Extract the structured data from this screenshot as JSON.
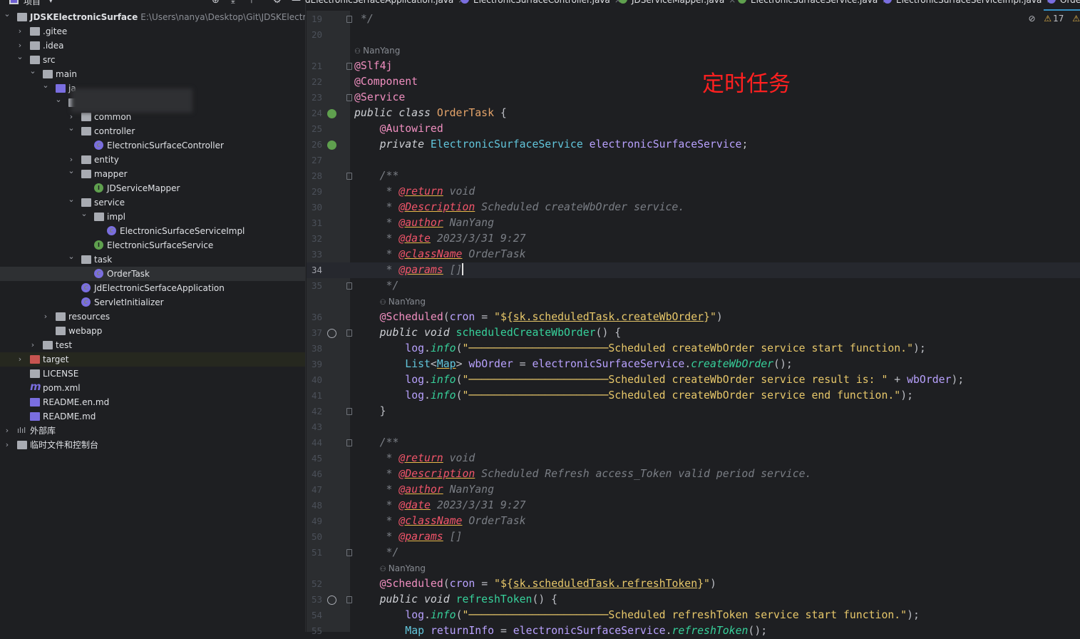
{
  "project_panel": {
    "title": "项目",
    "tree": [
      {
        "depth": 0,
        "exp": true,
        "icon": "module",
        "label": "JDSKElectronicSurface",
        "path": "E:\\Users\\nanya\\Desktop\\Git\\JDSKElectronicSurf",
        "bold": true
      },
      {
        "depth": 1,
        "exp": false,
        "icon": "folder",
        "label": ".gitee"
      },
      {
        "depth": 1,
        "exp": false,
        "icon": "folder",
        "label": ".idea"
      },
      {
        "depth": 1,
        "exp": true,
        "icon": "folder",
        "label": "src"
      },
      {
        "depth": 2,
        "exp": true,
        "icon": "folder",
        "label": "main"
      },
      {
        "depth": 3,
        "exp": true,
        "icon": "folder-blue",
        "label": "ja"
      },
      {
        "depth": 4,
        "exp": true,
        "icon": "package",
        "label": ""
      },
      {
        "depth": 5,
        "exp": false,
        "icon": "package",
        "label": "common"
      },
      {
        "depth": 5,
        "exp": true,
        "icon": "package",
        "label": "controller"
      },
      {
        "depth": 6,
        "icon": "class",
        "label": "ElectronicSurfaceController"
      },
      {
        "depth": 5,
        "exp": false,
        "icon": "package",
        "label": "entity"
      },
      {
        "depth": 5,
        "exp": true,
        "icon": "package",
        "label": "mapper"
      },
      {
        "depth": 6,
        "icon": "interface",
        "label": "JDServiceMapper"
      },
      {
        "depth": 5,
        "exp": true,
        "icon": "package",
        "label": "service"
      },
      {
        "depth": 6,
        "exp": true,
        "icon": "package",
        "label": "impl"
      },
      {
        "depth": 7,
        "icon": "class",
        "label": "ElectronicSurfaceServiceImpl"
      },
      {
        "depth": 6,
        "icon": "interface",
        "label": "ElectronicSurfaceService"
      },
      {
        "depth": 5,
        "exp": true,
        "icon": "package",
        "label": "task"
      },
      {
        "depth": 6,
        "icon": "class",
        "label": "OrderTask",
        "selected": true
      },
      {
        "depth": 5,
        "icon": "class",
        "label": "JdElectronicSerfaceApplication"
      },
      {
        "depth": 5,
        "icon": "class",
        "label": "ServletInitializer"
      },
      {
        "depth": 3,
        "exp": false,
        "icon": "folder",
        "label": "resources"
      },
      {
        "depth": 3,
        "icon": "folder",
        "label": "webapp"
      },
      {
        "depth": 2,
        "exp": false,
        "icon": "folder",
        "label": "test"
      },
      {
        "depth": 1,
        "exp": false,
        "icon": "folder-red",
        "label": "target",
        "excluded": true
      },
      {
        "depth": 1,
        "icon": "file",
        "label": "LICENSE"
      },
      {
        "depth": 1,
        "icon": "maven",
        "label": "pom.xml"
      },
      {
        "depth": 1,
        "icon": "md",
        "label": "README.en.md"
      },
      {
        "depth": 1,
        "icon": "md",
        "label": "README.md"
      },
      {
        "depth": 0,
        "exp": false,
        "icon": "library",
        "label": "外部库"
      },
      {
        "depth": 0,
        "exp": false,
        "icon": "scratch",
        "label": "临时文件和控制台"
      }
    ]
  },
  "tabs": [
    {
      "label": "JdElectronicSerfaceApplication.java",
      "type": "class"
    },
    {
      "label": "ElectronicSurfaceController.java",
      "type": "class"
    },
    {
      "label": "JDServiceMapper.java",
      "type": "interface"
    },
    {
      "label": "ElectronicSurfaceService.java",
      "type": "interface"
    },
    {
      "label": "ElectronicSurfaceServiceImpl.java",
      "type": "class"
    },
    {
      "label": "OrderTask.java",
      "type": "class",
      "active": true
    }
  ],
  "inspections": {
    "warnings": "17",
    "warning_icon": "warning-triangle",
    "reader_icon": "eye-crossed"
  },
  "overlay_note": "定时任务",
  "editor": {
    "current_line": 34,
    "rows": [
      {
        "ln": 19,
        "fold": true,
        "seg": [
          [
            "c",
            " */"
          ]
        ]
      },
      {
        "ln": 20,
        "seg": []
      },
      {
        "hint": "NanYang",
        "indent": 0
      },
      {
        "ln": 21,
        "fold": true,
        "seg": [
          [
            "a",
            "@Slf4j"
          ]
        ]
      },
      {
        "ln": 22,
        "seg": [
          [
            "a",
            "@Component"
          ]
        ]
      },
      {
        "ln": 23,
        "fold": true,
        "seg": [
          [
            "a",
            "@Service"
          ]
        ]
      },
      {
        "ln": 24,
        "icon": "bean",
        "seg": [
          [
            "k",
            "public class "
          ],
          [
            "cl",
            "OrderTask"
          ],
          [
            "p",
            " {"
          ]
        ]
      },
      {
        "ln": 25,
        "seg": [
          [
            "p",
            "    "
          ],
          [
            "a",
            "@Autowired"
          ]
        ]
      },
      {
        "ln": 26,
        "icon": "bean",
        "seg": [
          [
            "p",
            "    "
          ],
          [
            "k",
            "private "
          ],
          [
            "ty",
            "ElectronicSurfaceService"
          ],
          [
            "p",
            " "
          ],
          [
            "f",
            "electronicSurfaceService"
          ],
          [
            "p",
            ";"
          ]
        ]
      },
      {
        "ln": 27,
        "seg": []
      },
      {
        "ln": 28,
        "fold": true,
        "seg": [
          [
            "c",
            "    /**"
          ]
        ]
      },
      {
        "ln": 29,
        "seg": [
          [
            "c",
            "     * "
          ],
          [
            "t",
            "@return"
          ],
          [
            "c",
            " void"
          ]
        ]
      },
      {
        "ln": 30,
        "seg": [
          [
            "c",
            "     * "
          ],
          [
            "t",
            "@Description"
          ],
          [
            "c",
            " Scheduled createWbOrder service."
          ]
        ]
      },
      {
        "ln": 31,
        "seg": [
          [
            "c",
            "     * "
          ],
          [
            "t",
            "@author"
          ],
          [
            "c",
            " NanYang"
          ]
        ]
      },
      {
        "ln": 32,
        "seg": [
          [
            "c",
            "     * "
          ],
          [
            "t",
            "@date"
          ],
          [
            "c",
            " 2023/3/31 9:27"
          ]
        ]
      },
      {
        "ln": 33,
        "seg": [
          [
            "c",
            "     * "
          ],
          [
            "t",
            "@className"
          ],
          [
            "c",
            " OrderTask"
          ]
        ]
      },
      {
        "ln": 34,
        "caret": true,
        "seg": [
          [
            "c",
            "     * "
          ],
          [
            "t",
            "@params"
          ],
          [
            "c",
            " []"
          ]
        ]
      },
      {
        "ln": 35,
        "fold": true,
        "seg": [
          [
            "c",
            "     */"
          ]
        ]
      },
      {
        "hint": "NanYang",
        "indent": 4
      },
      {
        "ln": 36,
        "seg": [
          [
            "p",
            "    "
          ],
          [
            "a",
            "@Scheduled"
          ],
          [
            "p",
            "("
          ],
          [
            "f",
            "cron"
          ],
          [
            "p",
            " = "
          ],
          [
            "s",
            "\"${"
          ],
          [
            "su",
            "sk.scheduledTask.createWbOrder"
          ],
          [
            "s",
            "}\""
          ],
          [
            "p",
            ")"
          ]
        ]
      },
      {
        "ln": 37,
        "icon": "clock",
        "fold": true,
        "seg": [
          [
            "p",
            "    "
          ],
          [
            "k",
            "public void "
          ],
          [
            "m",
            "scheduledCreateWbOrder"
          ],
          [
            "p",
            "() {"
          ]
        ]
      },
      {
        "ln": 38,
        "seg": [
          [
            "p",
            "        "
          ],
          [
            "f",
            "log"
          ],
          [
            "p",
            "."
          ],
          [
            "mi",
            "info"
          ],
          [
            "p",
            "("
          ],
          [
            "s",
            "\"──────────────────────Scheduled createWbOrder service start function.\""
          ],
          [
            "p",
            ");"
          ]
        ]
      },
      {
        "ln": 39,
        "seg": [
          [
            "p",
            "        "
          ],
          [
            "ty",
            "List"
          ],
          [
            "p",
            "<"
          ],
          [
            "tu",
            "Map"
          ],
          [
            "p",
            "> "
          ],
          [
            "f",
            "wbOrder"
          ],
          [
            "p",
            " = "
          ],
          [
            "f",
            "electronicSurfaceService"
          ],
          [
            "p",
            "."
          ],
          [
            "mi",
            "createWbOrder"
          ],
          [
            "p",
            "();"
          ]
        ]
      },
      {
        "ln": 40,
        "seg": [
          [
            "p",
            "        "
          ],
          [
            "f",
            "log"
          ],
          [
            "p",
            "."
          ],
          [
            "mi",
            "info"
          ],
          [
            "p",
            "("
          ],
          [
            "s",
            "\"──────────────────────Scheduled createWbOrder service result is: \""
          ],
          [
            "p",
            " + "
          ],
          [
            "f",
            "wbOrder"
          ],
          [
            "p",
            ");"
          ]
        ]
      },
      {
        "ln": 41,
        "seg": [
          [
            "p",
            "        "
          ],
          [
            "f",
            "log"
          ],
          [
            "p",
            "."
          ],
          [
            "mi",
            "info"
          ],
          [
            "p",
            "("
          ],
          [
            "s",
            "\"──────────────────────Scheduled createWbOrder service end function.\""
          ],
          [
            "p",
            ");"
          ]
        ]
      },
      {
        "ln": 42,
        "fold": true,
        "seg": [
          [
            "p",
            "    }"
          ]
        ]
      },
      {
        "ln": 43,
        "seg": []
      },
      {
        "ln": 44,
        "fold": true,
        "seg": [
          [
            "c",
            "    /**"
          ]
        ]
      },
      {
        "ln": 45,
        "seg": [
          [
            "c",
            "     * "
          ],
          [
            "t",
            "@return"
          ],
          [
            "c",
            " void"
          ]
        ]
      },
      {
        "ln": 46,
        "seg": [
          [
            "c",
            "     * "
          ],
          [
            "t",
            "@Description"
          ],
          [
            "c",
            " Scheduled Refresh access_Token valid period service."
          ]
        ]
      },
      {
        "ln": 47,
        "seg": [
          [
            "c",
            "     * "
          ],
          [
            "t",
            "@author"
          ],
          [
            "c",
            " NanYang"
          ]
        ]
      },
      {
        "ln": 48,
        "seg": [
          [
            "c",
            "     * "
          ],
          [
            "t",
            "@date"
          ],
          [
            "c",
            " 2023/3/31 9:27"
          ]
        ]
      },
      {
        "ln": 49,
        "seg": [
          [
            "c",
            "     * "
          ],
          [
            "t",
            "@className"
          ],
          [
            "c",
            " OrderTask"
          ]
        ]
      },
      {
        "ln": 50,
        "seg": [
          [
            "c",
            "     * "
          ],
          [
            "t",
            "@params"
          ],
          [
            "c",
            " []"
          ]
        ]
      },
      {
        "ln": 51,
        "fold": true,
        "seg": [
          [
            "c",
            "     */"
          ]
        ]
      },
      {
        "hint": "NanYang",
        "indent": 4
      },
      {
        "ln": 52,
        "seg": [
          [
            "p",
            "    "
          ],
          [
            "a",
            "@Scheduled"
          ],
          [
            "p",
            "("
          ],
          [
            "f",
            "cron"
          ],
          [
            "p",
            " = "
          ],
          [
            "s",
            "\"${"
          ],
          [
            "su",
            "sk.scheduledTask.refreshToken"
          ],
          [
            "s",
            "}\""
          ],
          [
            "p",
            ")"
          ]
        ]
      },
      {
        "ln": 53,
        "icon": "clock",
        "fold": true,
        "seg": [
          [
            "p",
            "    "
          ],
          [
            "k",
            "public void "
          ],
          [
            "m",
            "refreshToken"
          ],
          [
            "p",
            "() {"
          ]
        ]
      },
      {
        "ln": 54,
        "seg": [
          [
            "p",
            "        "
          ],
          [
            "f",
            "log"
          ],
          [
            "p",
            "."
          ],
          [
            "mi",
            "info"
          ],
          [
            "p",
            "("
          ],
          [
            "s",
            "\"──────────────────────Scheduled refreshToken service start function.\""
          ],
          [
            "p",
            ");"
          ]
        ]
      },
      {
        "ln": 55,
        "seg": [
          [
            "p",
            "        "
          ],
          [
            "ty",
            "Map"
          ],
          [
            "p",
            " "
          ],
          [
            "f",
            "returnInfo"
          ],
          [
            "p",
            " = "
          ],
          [
            "f",
            "electronicSurfaceService"
          ],
          [
            "p",
            "."
          ],
          [
            "mi",
            "refreshToken"
          ],
          [
            "p",
            "();"
          ]
        ]
      }
    ]
  }
}
